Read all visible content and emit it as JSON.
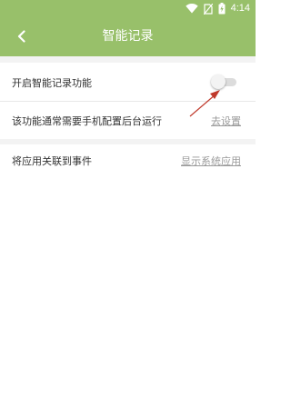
{
  "status_bar": {
    "time": "4:14",
    "icons": [
      "wifi-icon",
      "no-sim-icon",
      "battery-charging-icon"
    ]
  },
  "app_bar": {
    "title": "智能记录",
    "back_icon": "back-arrow-icon"
  },
  "settings": {
    "smart_record": {
      "label": "开启智能记录功能",
      "enabled": false
    },
    "background_run": {
      "label": "该功能通常需要手机配置后台运行",
      "link": "去设置"
    },
    "link_apps": {
      "label": "将应用关联到事件",
      "link": "显示系统应用"
    }
  },
  "colors": {
    "primary": "#98c06a",
    "divider": "#e8e8e8",
    "section_gap": "#f3f3f3",
    "link_text": "#9a9a9a",
    "annotation_arrow": "#c0392b"
  }
}
